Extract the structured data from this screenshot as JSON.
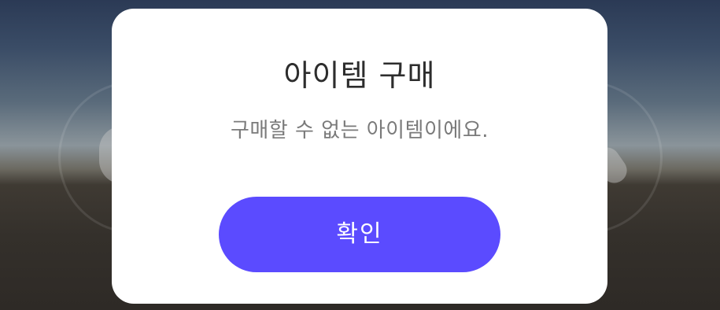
{
  "dialog": {
    "title": "아이템 구매",
    "message": "구매할 수 없는 아이템이에요.",
    "confirm_label": "확인"
  },
  "colors": {
    "accent": "#5b4bff",
    "dialog_background": "#ffffff",
    "title_text": "#2d2d2d",
    "message_text": "#7a7a7a"
  }
}
